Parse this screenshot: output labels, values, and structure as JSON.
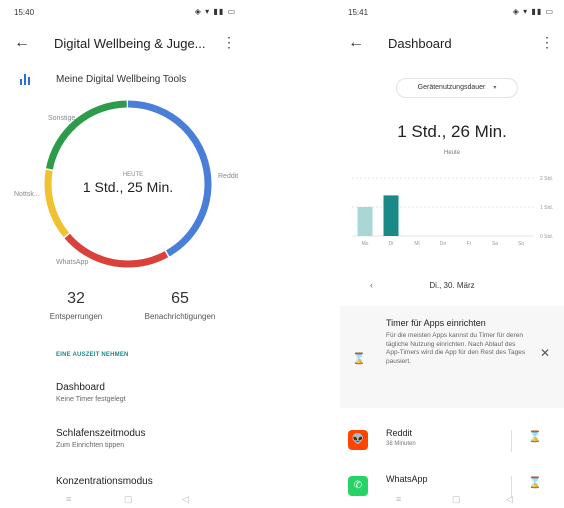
{
  "left": {
    "status": {
      "time": "15:40",
      "icons": "◐ ✓ ▣ ●",
      "right_icons": "◈ ▾ ▮▮ ▭"
    },
    "appbar": {
      "back": "←",
      "title": "Digital Wellbeing & Juge...",
      "more": "⋮"
    },
    "tools_label": "Meine Digital Wellbeing Tools",
    "donut": {
      "center_small": "HEUTE",
      "center_big": "1 Std., 25 Min.",
      "segments": [
        {
          "name": "Reddit",
          "color": "#4a7fd9",
          "fraction": 0.42
        },
        {
          "name": "WhatsApp",
          "color": "#d9413a",
          "fraction": 0.22
        },
        {
          "name": "Nottsk...",
          "color": "#f0c230",
          "fraction": 0.14
        },
        {
          "name": "Sonstige",
          "color": "#2e9b4a",
          "fraction": 0.22
        }
      ],
      "labels": {
        "reddit": "Reddit",
        "whatsapp": "WhatsApp",
        "nottsk": "Nottsk...",
        "sonstige": "Sonstige"
      }
    },
    "stats": {
      "unlocks_value": "32",
      "unlocks_label": "Entsperrungen",
      "notifs_value": "65",
      "notifs_label": "Benachrichtigungen"
    },
    "section_head": "EINE AUSZEIT NEHMEN",
    "menu": {
      "dashboard_title": "Dashboard",
      "dashboard_sub": "Keine Timer festgelegt",
      "sleep_title": "Schlafenszeitmodus",
      "sleep_sub": "Zum Einrichten tippen",
      "focus_title": "Konzentrationsmodus"
    },
    "nav": {
      "menu": "≡",
      "home": "▢",
      "back": "◁"
    }
  },
  "right": {
    "status": {
      "time": "15:41",
      "icons": "◐ ✓ ▣ ● •",
      "right_icons": "◈ ▾ ▮▮ ▭"
    },
    "appbar": {
      "back": "←",
      "title": "Dashboard",
      "more": "⋮"
    },
    "dropdown": {
      "label": "Gerätenutzungsdauer",
      "caret": "▾"
    },
    "big_time": "1 Std., 26 Min.",
    "big_sub": "Heute",
    "chart_data": {
      "type": "bar",
      "categories": [
        "Mo",
        "Di",
        "Mi",
        "Do",
        "Fr",
        "Sa",
        "So"
      ],
      "values": [
        1.0,
        1.4,
        0,
        0,
        0,
        0,
        0
      ],
      "yticks": [
        "2 Std.",
        "1 Std.",
        "0 Std."
      ],
      "colors": [
        "#a9d7d6",
        "#1a8a86"
      ],
      "ylim": [
        0,
        2
      ]
    },
    "date_row": {
      "prev": "‹",
      "date": "Di., 30. März"
    },
    "timer_card": {
      "icon": "⌛",
      "title": "Timer für Apps einrichten",
      "desc": "Für die meisten Apps kannst du Timer für deren tägliche Nutzung einrichten. Nach Ablauf des App-Timers wird die App für den Rest des Tages pausiert.",
      "close": "✕"
    },
    "apps": {
      "reddit_name": "Reddit",
      "reddit_sub": "38 Minuten",
      "reddit_color": "#ff4500",
      "whatsapp_name": "WhatsApp",
      "whatsapp_color": "#25d366"
    },
    "nav": {
      "menu": "≡",
      "home": "▢",
      "back": "◁"
    }
  }
}
